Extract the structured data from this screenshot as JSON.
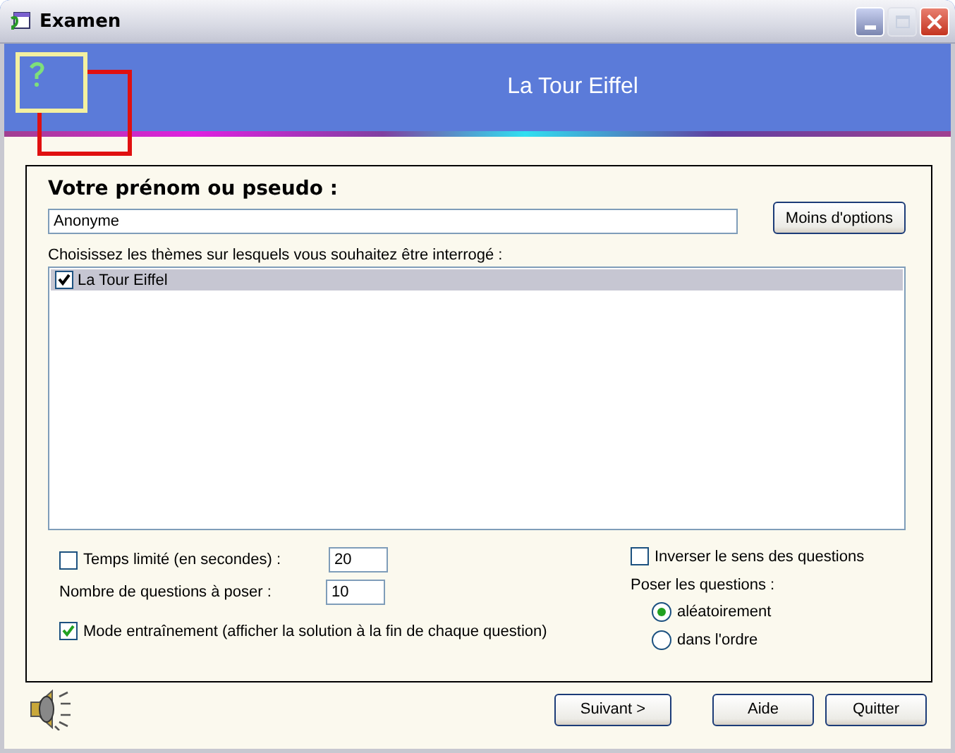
{
  "window": {
    "title": "Examen"
  },
  "banner": {
    "title": "La Tour Eiffel"
  },
  "name_label": "Votre prénom ou pseudo :",
  "name_field": {
    "value": "Anonyme"
  },
  "options_button": "Moins d'options",
  "themes_label": "Choisissez les thèmes sur lesquels vous souhaitez être interrogé :",
  "themes": [
    {
      "label": "La Tour Eiffel",
      "checked": true,
      "selected": true
    }
  ],
  "time_limit": {
    "label": "Temps limité (en secondes) :",
    "checked": false,
    "value": "20"
  },
  "question_count": {
    "label": "Nombre de questions à poser :",
    "value": "10"
  },
  "training_mode": {
    "label": "Mode entraînement (afficher la solution à la fin de chaque question)",
    "checked": true
  },
  "reverse": {
    "label": "Inverser le sens des questions",
    "checked": false
  },
  "order_label": "Poser les questions :",
  "order_options": [
    {
      "label": "aléatoirement",
      "selected": true
    },
    {
      "label": "dans l'ordre",
      "selected": false
    }
  ],
  "buttons": [
    "Suivant >",
    "Aide",
    "Quitter"
  ]
}
